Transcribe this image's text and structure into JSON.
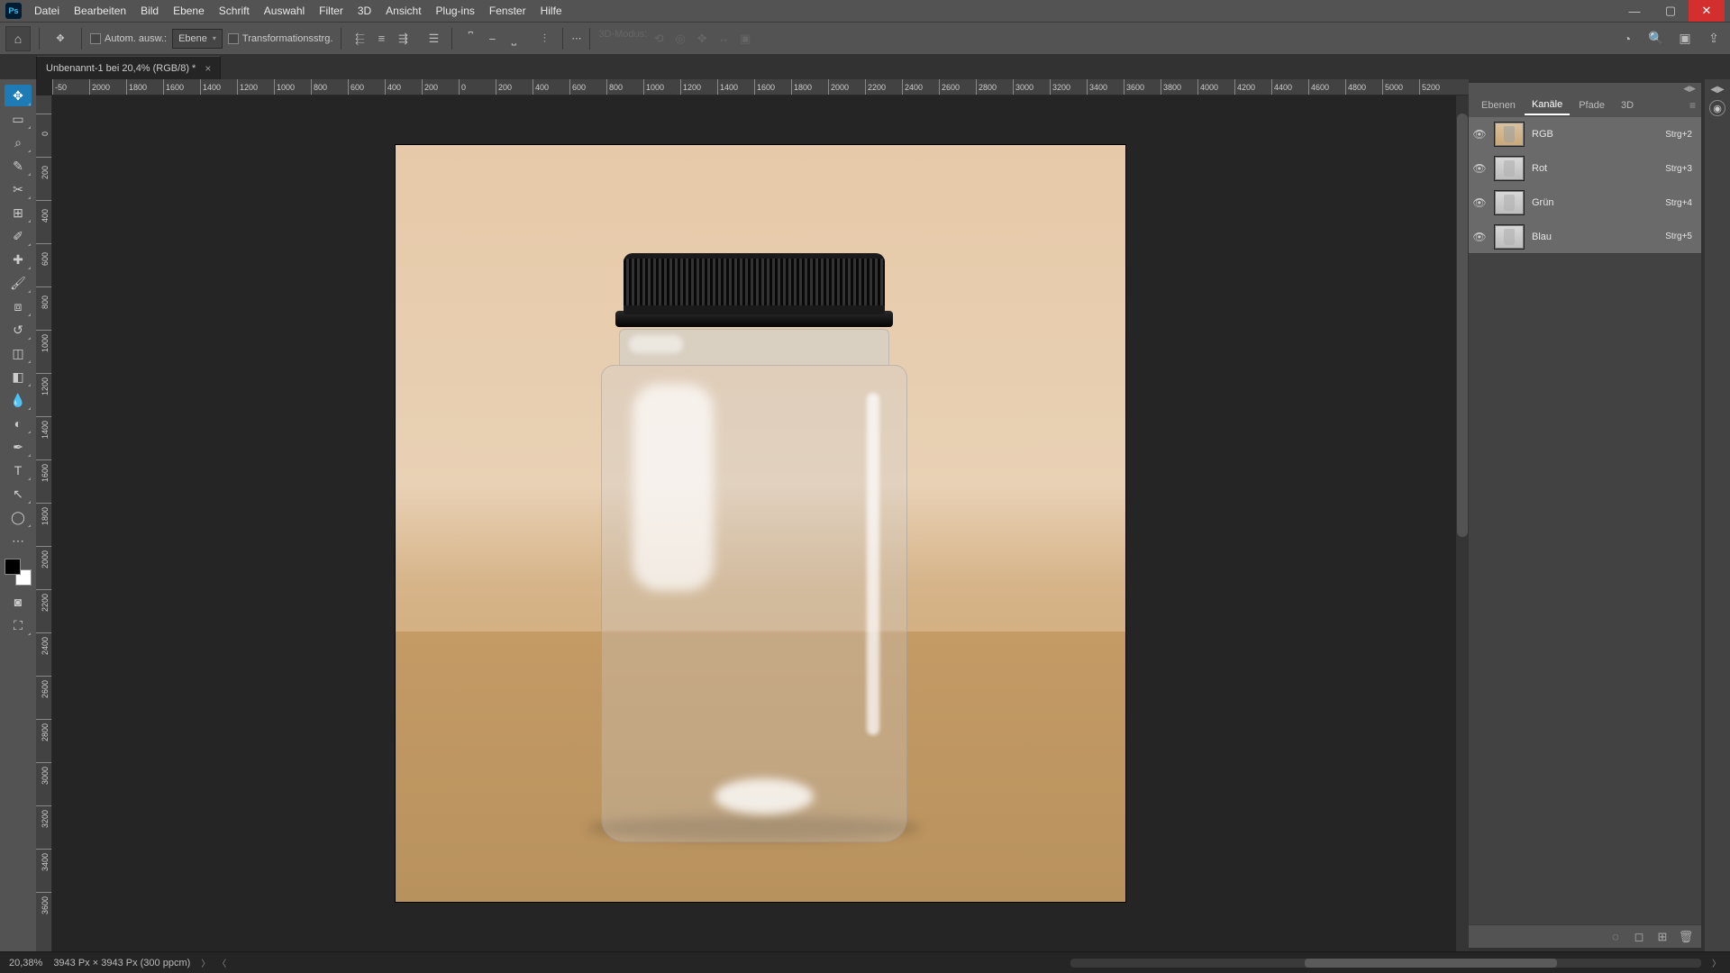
{
  "menu": {
    "items": [
      "Datei",
      "Bearbeiten",
      "Bild",
      "Ebene",
      "Schrift",
      "Auswahl",
      "Filter",
      "3D",
      "Ansicht",
      "Plug-ins",
      "Fenster",
      "Hilfe"
    ]
  },
  "options": {
    "auto_select_label": "Autom. ausw.:",
    "layer_dropdown": "Ebene",
    "transform_label": "Transformationsstrg.",
    "mode_label": "3D-Modus:"
  },
  "doc_tab": {
    "title": "Unbenannt-1 bei 20,4% (RGB/8) *"
  },
  "ruler_h": [
    "-50",
    "2000",
    "1800",
    "1600",
    "1400",
    "1200",
    "1000",
    "800",
    "600",
    "400",
    "200",
    "0",
    "200",
    "400",
    "600",
    "800",
    "1000",
    "1200",
    "1400",
    "1600",
    "1800",
    "2000",
    "2200",
    "2400",
    "2600",
    "2800",
    "3000",
    "3200",
    "3400",
    "3600",
    "3800",
    "4000",
    "4200",
    "4400",
    "4600",
    "4800",
    "5000",
    "5200"
  ],
  "ruler_v": [
    "0",
    "200",
    "400",
    "600",
    "800",
    "1000",
    "1200",
    "1400",
    "1600",
    "1800",
    "2000",
    "2200",
    "2400",
    "2600",
    "2800",
    "3000",
    "3200",
    "3400",
    "3600"
  ],
  "panels": {
    "tabs": {
      "ebenen": "Ebenen",
      "kanale": "Kanäle",
      "pfade": "Pfade",
      "d3": "3D"
    },
    "channels": [
      {
        "name": "RGB",
        "shortcut": "Strg+2",
        "gray": false
      },
      {
        "name": "Rot",
        "shortcut": "Strg+3",
        "gray": true
      },
      {
        "name": "Grün",
        "shortcut": "Strg+4",
        "gray": true
      },
      {
        "name": "Blau",
        "shortcut": "Strg+5",
        "gray": true
      }
    ]
  },
  "status": {
    "zoom": "20,38%",
    "dims": "3943 Px × 3943 Px (300 ppcm)"
  }
}
